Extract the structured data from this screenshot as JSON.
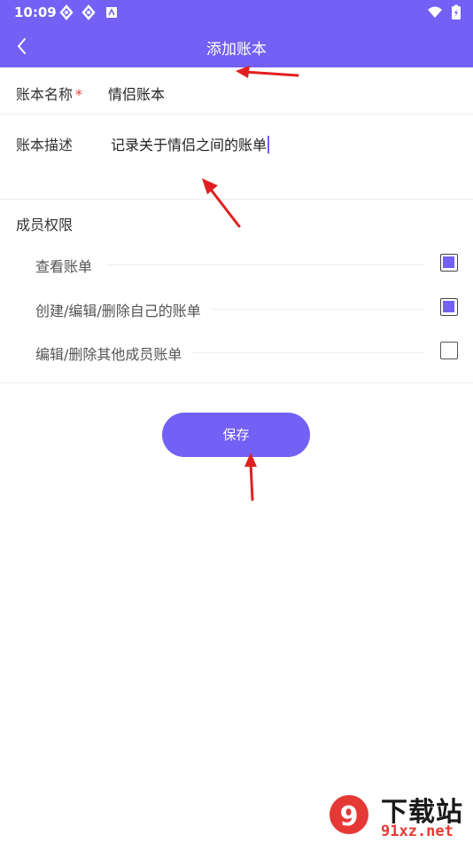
{
  "status_bar": {
    "time": "10:09"
  },
  "app_bar": {
    "title": "添加账本"
  },
  "form": {
    "name_label": "账本名称",
    "required_mark": "*",
    "name_value": "情侣账本",
    "desc_label": "账本描述",
    "desc_value": "记录关于情侣之间的账单"
  },
  "permissions": {
    "section_title": "成员权限",
    "items": [
      {
        "label": "查看账单",
        "checked": true
      },
      {
        "label": "创建/编辑/删除自己的账单",
        "checked": true
      },
      {
        "label": "编辑/删除其他成员账单",
        "checked": false
      }
    ]
  },
  "save_label": "保存",
  "watermark": {
    "title": "下载站",
    "url": "91xz.net"
  },
  "colors": {
    "accent": "#7360f4",
    "annotation_arrow": "#e02020"
  }
}
